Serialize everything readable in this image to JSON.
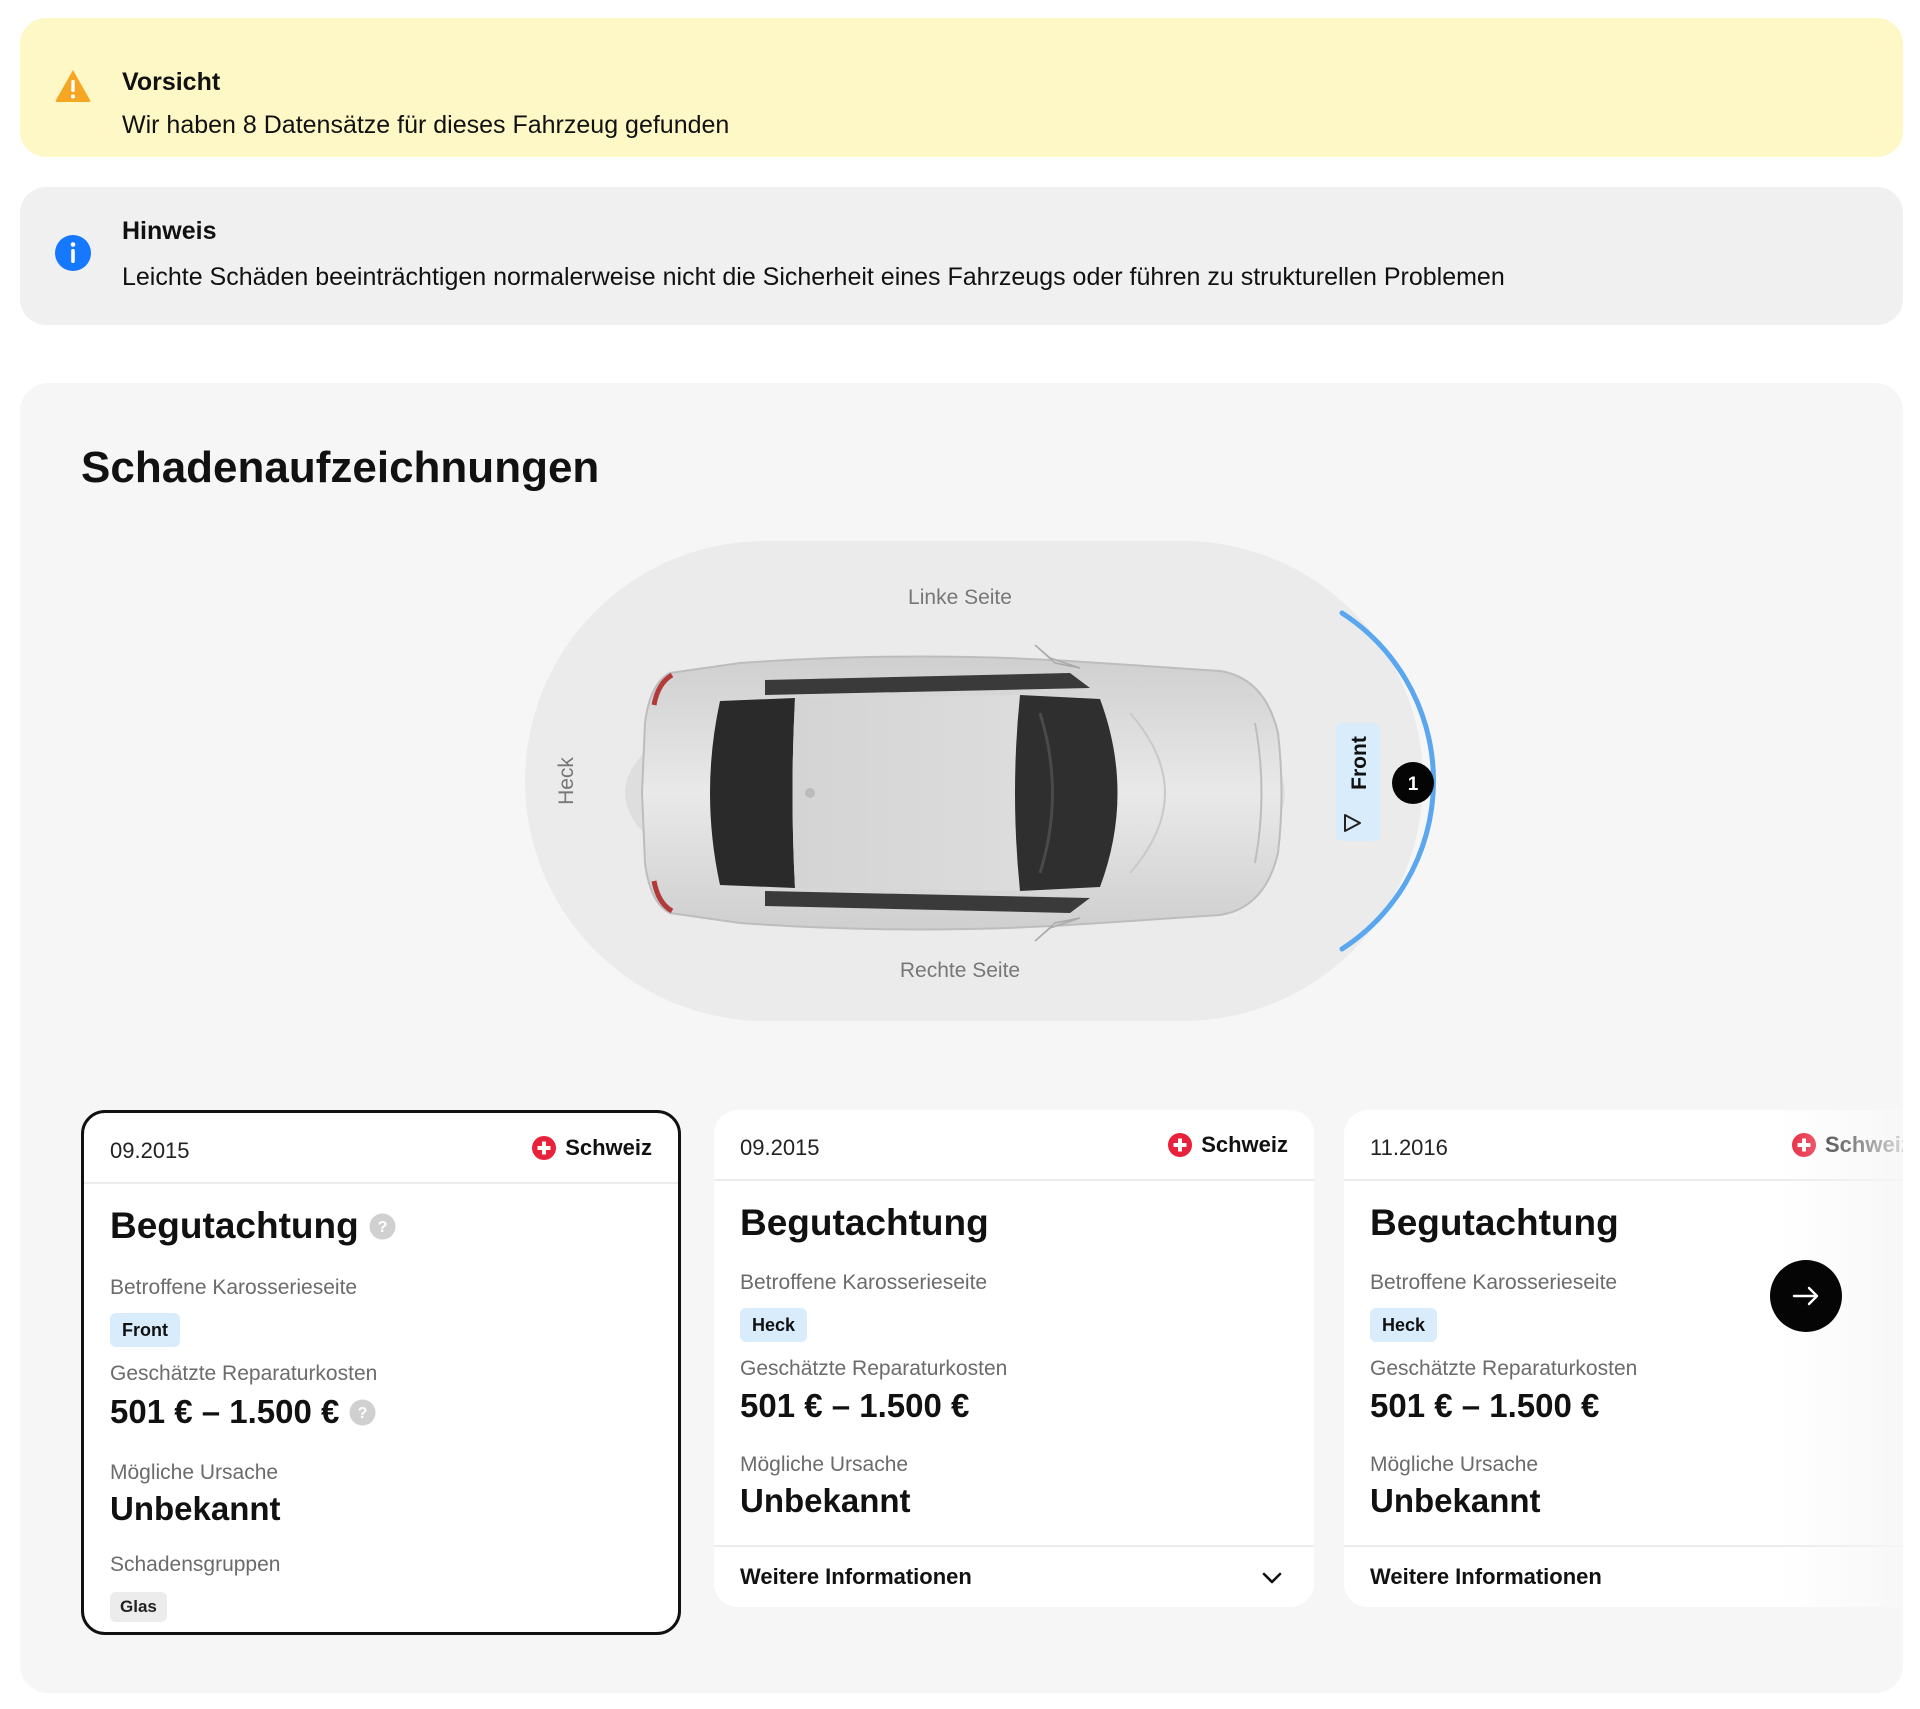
{
  "alerts": {
    "warning": {
      "title": "Vorsicht",
      "text": "Wir haben 8 Datensätze für dieses Fahrzeug gefunden",
      "color": "#f5a623"
    },
    "info": {
      "title": "Hinweis",
      "text": "Leichte Schäden beeinträchtigen normalerweise nicht die Sicherheit eines Fahrzeugs oder führen zu strukturellen Problemen",
      "color": "#1677ff"
    }
  },
  "damage_records": {
    "title": "Schadenaufzeichnungen",
    "diagram": {
      "left_side_label": "Linke Seite",
      "right_side_label": "Rechte Seite",
      "rear_label": "Heck",
      "front_label": "Front",
      "marker_count": "1",
      "highlight_color": "#5aa7f0"
    },
    "cards": [
      {
        "date": "09.2015",
        "country": "Schweiz",
        "title": "Begutachtung",
        "affected_side_label": "Betroffene Karosserieseite",
        "affected_side": "Front",
        "cost_label": "Geschätzte Reparaturkosten",
        "cost": "501 € – 1.500 €",
        "cause_label": "Mögliche Ursache",
        "cause": "Unbekannt",
        "groups_label": "Schadensgruppen",
        "group": "Glas",
        "selected": true
      },
      {
        "date": "09.2015",
        "country": "Schweiz",
        "title": "Begutachtung",
        "affected_side_label": "Betroffene Karosserieseite",
        "affected_side": "Heck",
        "cost_label": "Geschätzte Reparaturkosten",
        "cost": "501 € – 1.500 €",
        "cause_label": "Mögliche Ursache",
        "cause": "Unbekannt",
        "more_info": "Weitere Informationen"
      },
      {
        "date": "11.2016",
        "country": "Schweiz",
        "title": "Begutachtung",
        "affected_side_label": "Betroffene Karosserieseite",
        "affected_side": "Heck",
        "cost_label": "Geschätzte Reparaturkosten",
        "cost": "501 € – 1.500 €",
        "cause_label": "Mögliche Ursache",
        "cause": "Unbekannt",
        "more_info": "Weitere Informationen"
      }
    ],
    "next_button_icon": "arrow-right-icon"
  }
}
